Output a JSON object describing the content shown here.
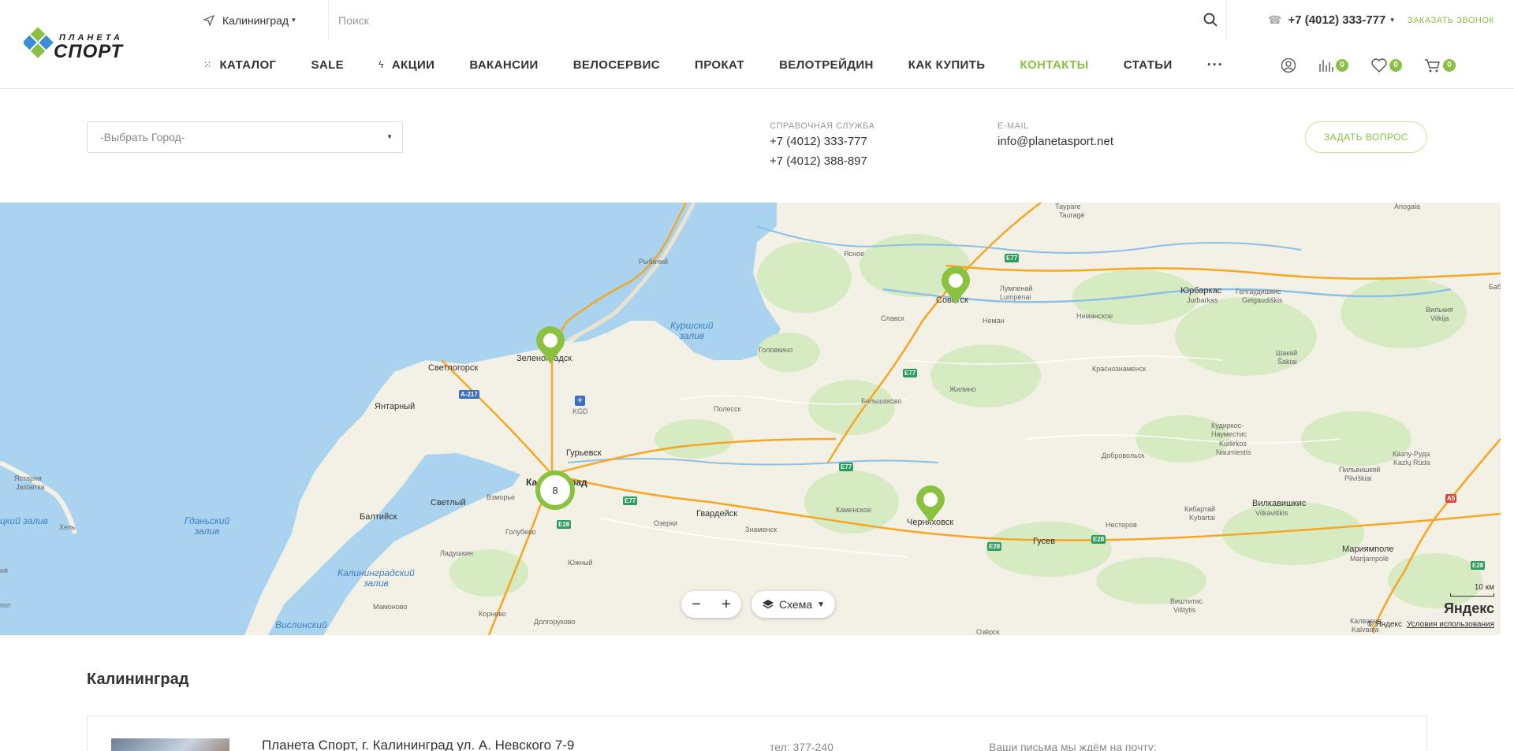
{
  "header": {
    "logo_text_top": "ПЛАНЕТА",
    "logo_text_bottom": "СПОРТ",
    "city": "Калининград",
    "search_placeholder": "Поиск",
    "phone": "+7 (4012) 333-777",
    "callback": "ЗАКАЗАТЬ ЗВОНОК",
    "nav": [
      {
        "label": "КАТАЛОГ"
      },
      {
        "label": "SALE"
      },
      {
        "label": "АКЦИИ"
      },
      {
        "label": "ВАКАНСИИ"
      },
      {
        "label": "ВЕЛОСЕРВИС"
      },
      {
        "label": "ПРОКАТ"
      },
      {
        "label": "ВЕЛОТРЕЙДИН"
      },
      {
        "label": "КАК КУПИТЬ"
      },
      {
        "label": "КОНТАКТЫ"
      },
      {
        "label": "СТАТЬИ"
      },
      {
        "label": "···"
      }
    ],
    "compare_count": "0",
    "favorites_count": "0",
    "cart_count": "0"
  },
  "contacts": {
    "city_select_placeholder": "-Выбрать Город-",
    "help_label": "СПРАВОЧНАЯ СЛУЖБА",
    "help_phone_1": "+7 (4012) 333-777",
    "help_phone_2": "+7 (4012) 388-897",
    "email_label": "E-MAIL",
    "email": "info@planetasport.net",
    "ask_button": "ЗАДАТЬ ВОПРОС"
  },
  "map": {
    "cluster_count": "8",
    "layers_label": "Схема",
    "scale_label": "10 км",
    "brand": "Яндекс",
    "copyright": "© Яндекс",
    "terms": "Условия использования",
    "places": {
      "zelenogradsk": "Зеленоградск",
      "svetlogorsk": "Светлогорск",
      "yantarny": "Янтарный",
      "kaliningrad": "Калининград",
      "guryevsk": "Гурьевск",
      "svetly": "Светлый",
      "vzmorye": "Взморье",
      "baltiysk": "Балтийск",
      "golubevo": "Голубево",
      "ladushkin": "Ладушкин",
      "yuzhny": "Южный",
      "mamonovo": "Мамоново",
      "kornevo": "Корнево",
      "dolgorukovo": "Долгоруково",
      "rybachy": "Рыбачий",
      "kgd": "KGD",
      "polessk": "Полесск",
      "golovkino": "Головкино",
      "gvardeysk": "Гвардейск",
      "ozerki": "Озерки",
      "znamensk": "Знаменск",
      "kamenskoe": "Каменское",
      "chernyakhovsk": "Черняховск",
      "bolshakovo": "Большаково",
      "slavsk": "Славск",
      "sovetsk": "Советск",
      "neman": "Неман",
      "zhilino": "Жилино",
      "yasnoe": "Ясное",
      "taurage": "Таураге",
      "taurage_en": "Tauragė",
      "lumpenai": "Лумпенай",
      "lumpenai_en": "Lumpėnai",
      "nemanskoe": "Неманское",
      "krasnoznamensk": "Краснознаменск",
      "jurbarkas": "Юрбаркас",
      "jurbarkas_en": "Jurbarkas",
      "gelgaudiskis": "Гелгаудишкис",
      "gelgaudiskis_en": "Gelgaudiškis",
      "vilkija": "Вилькия",
      "vilkija_en": "Vilkija",
      "sakiai": "Шакяй",
      "sakiai_en": "Šakiai",
      "kudirkos": "Кудиркос-",
      "kudirkos2": "Науместис",
      "kudirkos_en": "Kudirkos",
      "kudirkos_en2": "Naumiestis",
      "dobrovolsk": "Добровольск",
      "pilviskiai": "Пильвишкяй",
      "pilviskiai_en": "Pilviškiai",
      "kazlu_ruda": "Казлу-Руда",
      "kazlu_ruda_en": "Kazlų Rūda",
      "kybartai": "Кибартай",
      "kybartai_en": "Kybartai",
      "vilkaviskis": "Вилкавишкис",
      "vilkaviskis_en": "Vilkaviškis",
      "nesterov": "Нестеров",
      "gusev": "Гусев",
      "marijampole": "Мариямполе",
      "marijampole_en": "Marijampolė",
      "vistytis": "Виштитис",
      "vistytis_en": "Vištytis",
      "kalvarija": "Калвария",
      "kalvarija_en": "Kalvarija",
      "ozersk": "Озёрск",
      "ariogala": "Ariogala",
      "jastarnia": "Ястарня",
      "jastarnia_en": "Jastarnia",
      "hel": "Хель",
      "curonian_bay": "Куршский\nзалив",
      "gdansk_bay": "Гданьский\nзалив",
      "kaliningrad_bay": "Калининградский\nзалив",
      "vistula_bay": "Вислинский",
      "puck_bay": "цкий залив",
      "edge_ba": "Баб",
      "edge_ja": "ня",
      "edge_ot": "пот"
    },
    "roads": {
      "a217": "A-217",
      "e28": "E28",
      "e77": "E77",
      "a5": "A5"
    }
  },
  "city_section": {
    "title": "Калининград",
    "store_name": "Планета Спорт, г. Калининград ул. А. Невского 7-9",
    "store_tel": "тел: 377-240",
    "store_mail": "Ваши письма мы ждём на почту:"
  },
  "colors": {
    "accent": "#8ac13f",
    "water": "#aad3ef",
    "land": "#f3f0e6",
    "forest": "#d6ebc2",
    "road_major": "#f6a623"
  }
}
